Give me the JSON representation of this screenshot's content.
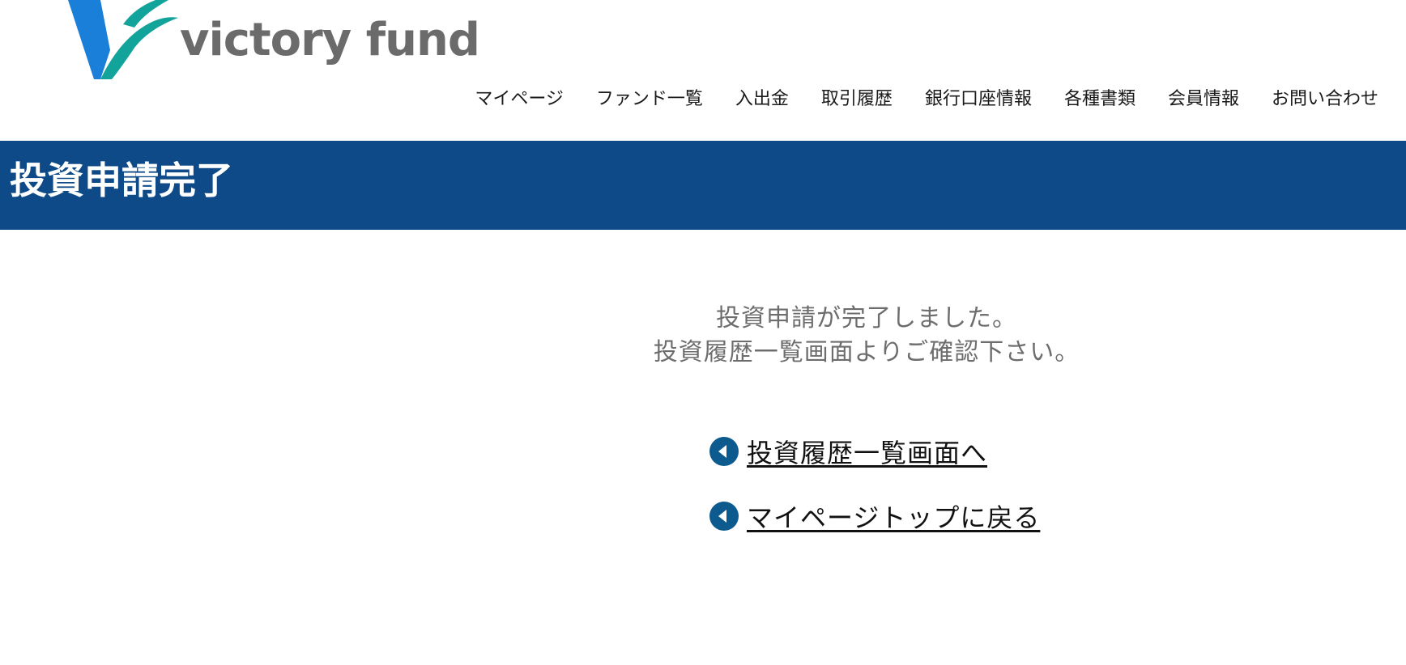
{
  "brand": {
    "name": "victory fund",
    "mark_icon": "victory-v-logo-icon",
    "colors": {
      "blue": "#1a7fd9",
      "teal": "#12a39a",
      "text_gray": "#6b6b6b"
    }
  },
  "nav": {
    "items": [
      {
        "label": "マイページ"
      },
      {
        "label": "ファンド一覧"
      },
      {
        "label": "入出金"
      },
      {
        "label": "取引履歴"
      },
      {
        "label": "銀行口座情報"
      },
      {
        "label": "各種書類"
      },
      {
        "label": "会員情報"
      },
      {
        "label": "お問い合わせ"
      }
    ]
  },
  "header": {
    "title": "投資申請完了",
    "bar_color": "#0e4a87"
  },
  "main": {
    "message_line1": "投資申請が完了しました。",
    "message_line2": "投資履歴一覧画面よりご確認下さい。",
    "links": [
      {
        "label": "投資履歴一覧画面へ",
        "icon": "chevron-left-circle-icon"
      },
      {
        "label": "マイページトップに戻る",
        "icon": "chevron-left-circle-icon"
      }
    ],
    "icon_color": "#0d5a8e"
  }
}
